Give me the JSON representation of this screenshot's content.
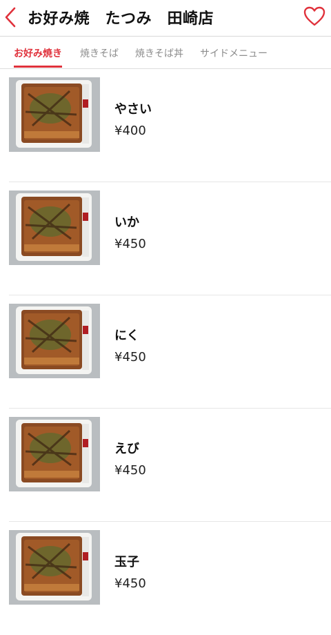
{
  "header": {
    "title": "お好み焼　たつみ　田崎店",
    "back_icon": "chevron-left-icon",
    "favorite_icon": "heart-icon",
    "accent_color": "#e0313b"
  },
  "tabs": [
    {
      "label": "お好み焼き",
      "active": true
    },
    {
      "label": "焼きそば",
      "active": false
    },
    {
      "label": "焼きそば丼",
      "active": false
    },
    {
      "label": "サイドメニュー",
      "active": false
    }
  ],
  "items": [
    {
      "name": "やさい",
      "price": "¥400"
    },
    {
      "name": "いか",
      "price": "¥450"
    },
    {
      "name": "にく",
      "price": "¥450"
    },
    {
      "name": "えび",
      "price": "¥450"
    },
    {
      "name": "玉子",
      "price": "¥450"
    }
  ]
}
